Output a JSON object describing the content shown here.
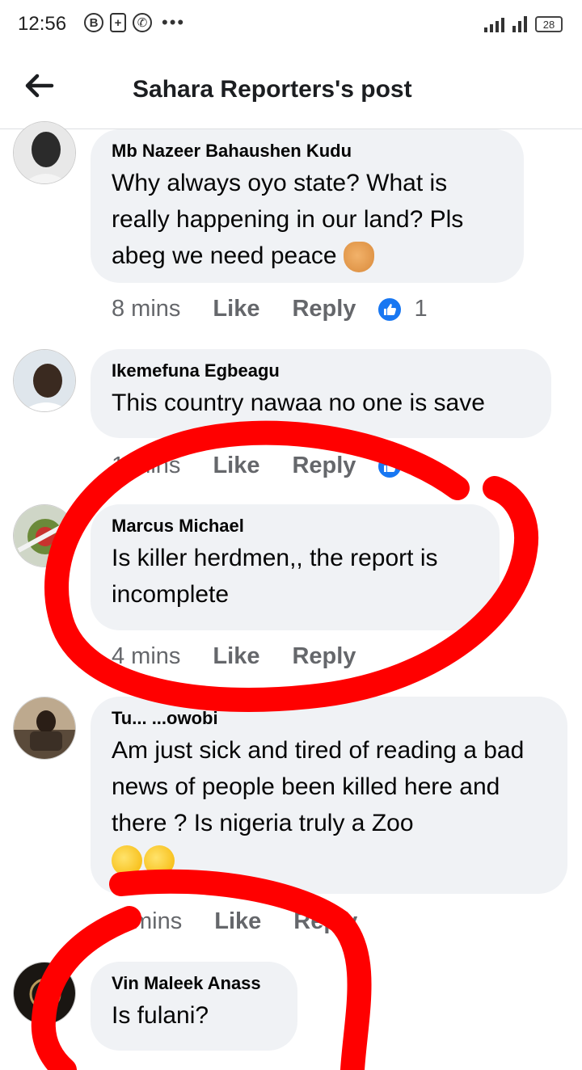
{
  "status_bar": {
    "time": "12:56",
    "icons": [
      "b-icon",
      "battery-saver-icon",
      "whatsapp-icon",
      "more-dots-icon"
    ],
    "battery_level": "28"
  },
  "header": {
    "title": "Sahara Reporters's post",
    "back_icon": "arrow-left-icon"
  },
  "comments": [
    {
      "author": "Mb Nazeer Bahaushen Kudu",
      "text": "Why always oyo state? What is really happening in our land? Pls abeg we need peace",
      "emoji": "clapping-hands",
      "time": "8 mins",
      "like": "Like",
      "reply": "Reply",
      "reaction_count": "1"
    },
    {
      "author": "Ikemefuna Egbeagu",
      "text": "This country nawaa no one is save",
      "time": "1",
      "time_suffix": "mins",
      "like": "Like",
      "reply": "Reply",
      "reaction_count": "1"
    },
    {
      "author": "Marcus Michael",
      "text": "Is killer herdmen,, the report is incomplete",
      "time": "4 mins",
      "like": "Like",
      "reply": "Reply"
    },
    {
      "author": "Tu... ...owobi",
      "text": "Am just sick and tired of reading a bad news of people been killed here and there ? Is nigeria truly a Zoo",
      "emoji": "sad-faces",
      "time": "mins",
      "like": "Like",
      "reply": "Reply"
    },
    {
      "author": "Vin Maleek Anass",
      "text": "Is fulani?"
    }
  ],
  "colors": {
    "bubble_bg": "#f0f2f5",
    "meta_text": "#65676b",
    "like_blue": "#1877f2",
    "marker_red": "#ff0000"
  }
}
